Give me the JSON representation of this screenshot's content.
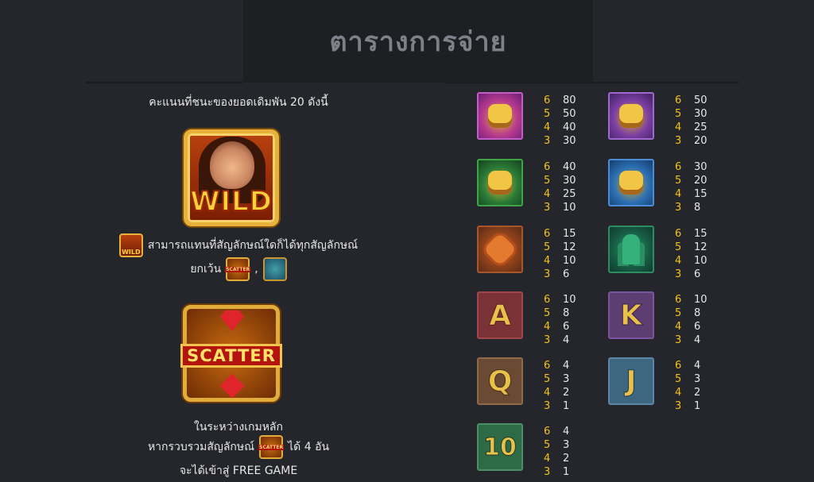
{
  "title": "ตารางการจ่าย",
  "left": {
    "bet_note": "คะแนนที่ชนะของยอดเดิมพัน 20 ดังนี้",
    "wild": {
      "label": "WILD",
      "desc": "สามารถแทนที่สัญลักษณ์ใดก็ได้ทุกสัญลักษณ์",
      "except_label": "ยกเว้น",
      "separator": ","
    },
    "scatter": {
      "label": "SCATTER",
      "line1": "ในระหว่างเกมหลัก",
      "line2_before": "หากรวบรวมสัญลักษณ์",
      "line2_after": "ได้ 4 อัน",
      "line3": "จะได้เข้าสู่ FREE GAME"
    }
  },
  "paytable": [
    {
      "icon": "red-mask-icon",
      "counts": [
        "6",
        "5",
        "4",
        "3"
      ],
      "values": [
        "80",
        "50",
        "40",
        "30"
      ]
    },
    {
      "icon": "purple-mask-icon",
      "counts": [
        "6",
        "5",
        "4",
        "3"
      ],
      "values": [
        "50",
        "30",
        "25",
        "20"
      ]
    },
    {
      "icon": "green-mask-icon",
      "counts": [
        "6",
        "5",
        "4",
        "3"
      ],
      "values": [
        "40",
        "30",
        "25",
        "10"
      ]
    },
    {
      "icon": "blue-mask-icon",
      "counts": [
        "6",
        "5",
        "4",
        "3"
      ],
      "values": [
        "30",
        "20",
        "15",
        "8"
      ]
    },
    {
      "icon": "flower-icon",
      "counts": [
        "6",
        "5",
        "4",
        "3"
      ],
      "values": [
        "15",
        "12",
        "10",
        "6"
      ]
    },
    {
      "icon": "cactus-icon",
      "counts": [
        "6",
        "5",
        "4",
        "3"
      ],
      "values": [
        "15",
        "12",
        "10",
        "6"
      ]
    },
    {
      "icon": "letter-a-icon",
      "glyph": "A",
      "counts": [
        "6",
        "5",
        "4",
        "3"
      ],
      "values": [
        "10",
        "8",
        "6",
        "4"
      ]
    },
    {
      "icon": "letter-k-icon",
      "glyph": "K",
      "counts": [
        "6",
        "5",
        "4",
        "3"
      ],
      "values": [
        "10",
        "8",
        "6",
        "4"
      ]
    },
    {
      "icon": "letter-q-icon",
      "glyph": "Q",
      "counts": [
        "6",
        "5",
        "4",
        "3"
      ],
      "values": [
        "4",
        "3",
        "2",
        "1"
      ]
    },
    {
      "icon": "letter-j-icon",
      "glyph": "J",
      "counts": [
        "6",
        "5",
        "4",
        "3"
      ],
      "values": [
        "4",
        "3",
        "2",
        "1"
      ]
    },
    {
      "icon": "number-10-icon",
      "glyph": "10",
      "counts": [
        "6",
        "5",
        "4",
        "3"
      ],
      "values": [
        "4",
        "3",
        "2",
        "1"
      ]
    }
  ]
}
